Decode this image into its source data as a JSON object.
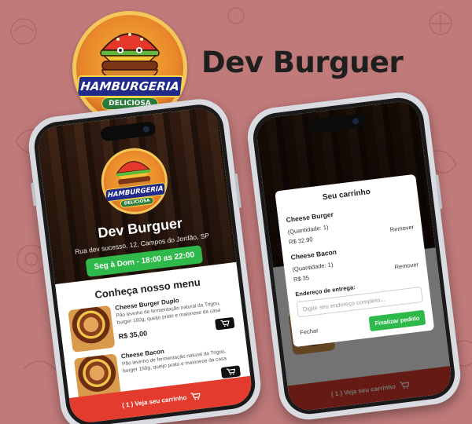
{
  "hero": {
    "title": "Dev Burguer",
    "logo_text": "HAMBURGERIA",
    "logo_sub": "DELICIOSA"
  },
  "app": {
    "name": "Dev Burguer",
    "address": "Rua dev sucesso, 12, Campos do Jordão, SP",
    "hours": "Seg à Dom - 18:00 as 22:00",
    "menu_title": "Conheça nosso menu",
    "products": [
      {
        "name": "Cheese Burger Duplo",
        "description": "Pão levinho de fermentação natural da Trigou, burger 160g, queijo prato e maionese da casa",
        "price": "R$ 35,00"
      },
      {
        "name": "Cheese Bacon",
        "description": "Pão levinho de fermentação natural da Trigou, burger 160g, queijo prato e maionese da casa",
        "price": ""
      }
    ],
    "cart_bar": "( 1 ) Veja seu carrinho"
  },
  "cart_modal": {
    "title": "Seu carrinho",
    "items": [
      {
        "name": "Cheese Burger",
        "qty": "(Quantidade: 1)",
        "price": "R$ 32.90",
        "remove": "Remover"
      },
      {
        "name": "Cheese Bacon",
        "qty": "(Quantidade: 1)",
        "price": "R$ 35",
        "remove": "Remover"
      }
    ],
    "address_label": "Endereço de entrega:",
    "address_placeholder": "Digite seu endereço completo...",
    "close": "Fechar",
    "finish": "Finalizar pedido"
  },
  "colors": {
    "background": "#c07a7a",
    "accent_green": "#2fb94a",
    "cart_red": "#e33b2e"
  },
  "icons": [
    "burger-logo-icon",
    "cart-icon"
  ]
}
